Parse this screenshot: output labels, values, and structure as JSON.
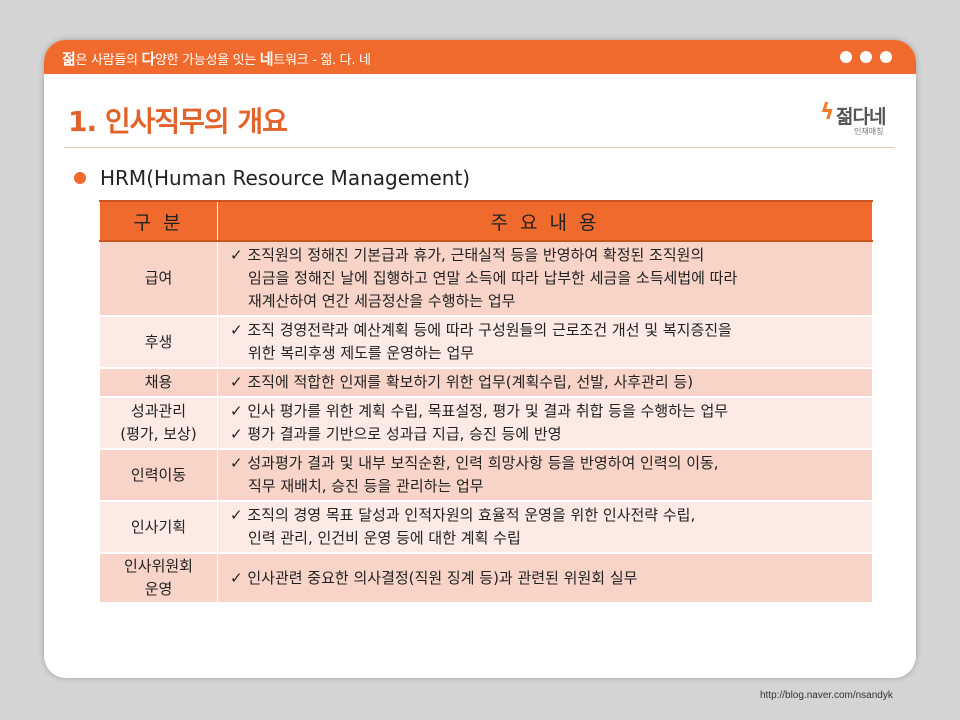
{
  "header": {
    "tagline": [
      {
        "text": "젊",
        "bold": true
      },
      {
        "text": "은 사람들의 ",
        "bold": false
      },
      {
        "text": "다",
        "bold": true
      },
      {
        "text": "양한 가능성을 잇는 ",
        "bold": false
      },
      {
        "text": "네",
        "bold": true
      },
      {
        "text": "트워크 - 젊. 다. 네",
        "bold": false
      }
    ],
    "accent_color": "#ef6a2c"
  },
  "title": "1. 인사직무의 개요",
  "logo": {
    "name": "젊다네",
    "sub": "인재매칭"
  },
  "bullet": "HRM(Human Resource Management)",
  "table": {
    "headers": [
      "구 분",
      "주 요 내 용"
    ],
    "rows": [
      {
        "category": [
          "급여"
        ],
        "items": [
          [
            "조직원의 정해진 기본급과 휴가, 근태실적 등을 반영하여 확정된 조직원의",
            "임금을 정해진 날에 집행하고 연말 소득에 따라 납부한 세금을 소득세법에 따라",
            "재계산하여 연간 세금정산을 수행하는 업무"
          ]
        ]
      },
      {
        "category": [
          "후생"
        ],
        "items": [
          [
            "조직 경영전략과 예산계획 등에 따라 구성원들의 근로조건 개선 및 복지증진을",
            "위한 복리후생 제도를 운영하는 업무"
          ]
        ]
      },
      {
        "category": [
          "채용"
        ],
        "items": [
          [
            "조직에 적합한 인재를 확보하기 위한 업무(계획수립, 선발, 사후관리 등)"
          ]
        ]
      },
      {
        "category": [
          "성과관리",
          "(평가, 보상)"
        ],
        "items": [
          [
            "인사 평가를 위한 계획 수립, 목표설정, 평가 및 결과 취합 등을 수행하는 업무"
          ],
          [
            "평가 결과를 기반으로 성과급 지급, 승진 등에 반영"
          ]
        ]
      },
      {
        "category": [
          "인력이동"
        ],
        "items": [
          [
            "성과평가 결과 및 내부 보직순환, 인력 희망사항 등을 반영하여 인력의 이동,",
            "직무 재배치, 승진 등을 관리하는 업무"
          ]
        ]
      },
      {
        "category": [
          "인사기획"
        ],
        "items": [
          [
            "조직의 경영 목표 달성과 인적자원의 효율적 운영을 위한 인사전략 수립,",
            "인력 관리, 인건비 운영 등에 대한 계획 수립"
          ]
        ]
      },
      {
        "category": [
          "인사위원회",
          "운영"
        ],
        "items": [
          [
            "인사관련 중요한 의사결정(직원 징계 등)과 관련된 위원회 실무"
          ]
        ]
      }
    ]
  },
  "footer_url": "http://blog.naver.com/nsandyk"
}
